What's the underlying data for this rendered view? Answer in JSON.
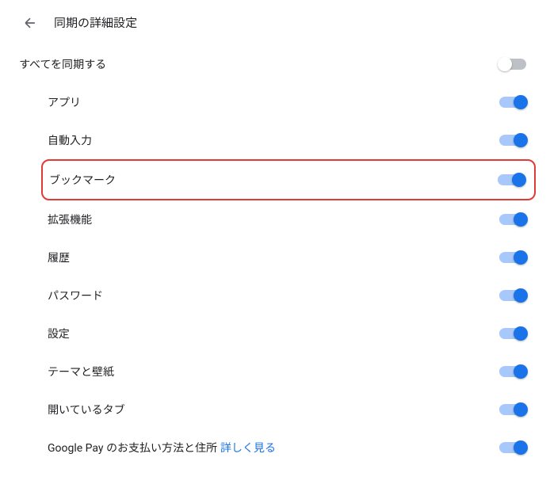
{
  "header": {
    "title": "同期の詳細設定"
  },
  "syncAll": {
    "label": "すべてを同期する",
    "enabled": false
  },
  "items": [
    {
      "label": "アプリ",
      "enabled": true,
      "highlighted": false
    },
    {
      "label": "自動入力",
      "enabled": true,
      "highlighted": false
    },
    {
      "label": "ブックマーク",
      "enabled": true,
      "highlighted": true
    },
    {
      "label": "拡張機能",
      "enabled": true,
      "highlighted": false
    },
    {
      "label": "履歴",
      "enabled": true,
      "highlighted": false
    },
    {
      "label": "パスワード",
      "enabled": true,
      "highlighted": false
    },
    {
      "label": "設定",
      "enabled": true,
      "highlighted": false
    },
    {
      "label": "テーマと壁紙",
      "enabled": true,
      "highlighted": false
    },
    {
      "label": "開いているタブ",
      "enabled": true,
      "highlighted": false
    },
    {
      "label": "Google Pay のお支払い方法と住所",
      "enabled": true,
      "highlighted": false,
      "learnMore": "詳しく見る"
    }
  ]
}
